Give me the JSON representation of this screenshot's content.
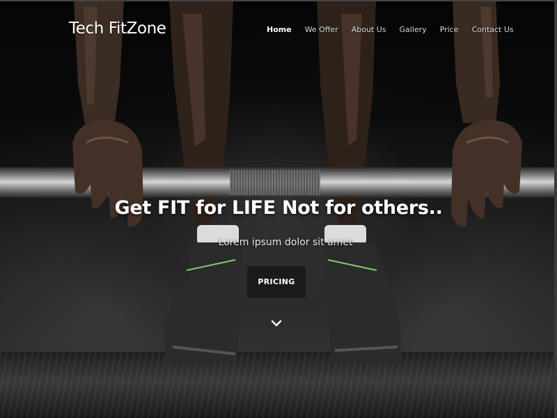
{
  "header": {
    "brand": "Tech FitZone",
    "nav": [
      {
        "label": "Home",
        "active": true
      },
      {
        "label": "We Offer",
        "active": false
      },
      {
        "label": "About Us",
        "active": false
      },
      {
        "label": "Gallery",
        "active": false
      },
      {
        "label": "Price",
        "active": false
      },
      {
        "label": "Contact Us",
        "active": false
      }
    ]
  },
  "hero": {
    "headline": "Get FIT for LIFE Not for others..",
    "subline": "Lorem ipsum dolor sit amet",
    "cta_label": "PRICING",
    "scroll_icon": "chevron-down-icon"
  },
  "colors": {
    "text": "#ffffff",
    "button_bg": "#1a1a1a",
    "background": "#0b0b0b"
  }
}
